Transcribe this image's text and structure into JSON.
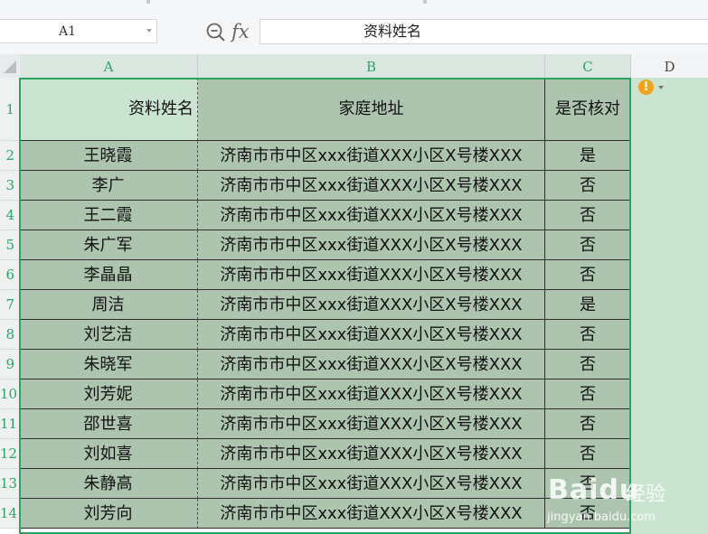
{
  "formula_bar": {
    "cell_ref": "A1",
    "fx_label": "fx",
    "content": "资料姓名"
  },
  "columns": [
    "A",
    "B",
    "C",
    "D"
  ],
  "header_row": {
    "row_num": "1",
    "a": "资料姓名",
    "b": "家庭地址",
    "c": "是否核对"
  },
  "rows": [
    {
      "row_num": "2",
      "name": "王晓霞",
      "address": "济南市市中区xxx街道XXX小区X号楼XXX",
      "checked": "是"
    },
    {
      "row_num": "3",
      "name": "李广",
      "address": "济南市市中区xxx街道XXX小区X号楼XXX",
      "checked": "否"
    },
    {
      "row_num": "4",
      "name": "王二霞",
      "address": "济南市市中区xxx街道XXX小区X号楼XXX",
      "checked": "否"
    },
    {
      "row_num": "5",
      "name": "朱广军",
      "address": "济南市市中区xxx街道XXX小区X号楼XXX",
      "checked": "否"
    },
    {
      "row_num": "6",
      "name": "李晶晶",
      "address": "济南市市中区xxx街道XXX小区X号楼XXX",
      "checked": "否"
    },
    {
      "row_num": "7",
      "name": "周洁",
      "address": "济南市市中区xxx街道XXX小区X号楼XXX",
      "checked": "是"
    },
    {
      "row_num": "8",
      "name": "刘艺洁",
      "address": "济南市市中区xxx街道XXX小区X号楼XXX",
      "checked": "否"
    },
    {
      "row_num": "9",
      "name": "朱晓军",
      "address": "济南市市中区xxx街道XXX小区X号楼XXX",
      "checked": "否"
    },
    {
      "row_num": "10",
      "name": "刘芳妮",
      "address": "济南市市中区xxx街道XXX小区X号楼XXX",
      "checked": "否"
    },
    {
      "row_num": "11",
      "name": "邵世喜",
      "address": "济南市市中区xxx街道XXX小区X号楼XXX",
      "checked": "否"
    },
    {
      "row_num": "12",
      "name": "刘如喜",
      "address": "济南市市中区xxx街道XXX小区X号楼XXX",
      "checked": "否"
    },
    {
      "row_num": "13",
      "name": "朱静高",
      "address": "济南市市中区xxx街道XXX小区X号楼XXX",
      "checked": "否"
    },
    {
      "row_num": "14",
      "name": "刘芳向",
      "address": "济南市市中区xxx街道XXX小区X号楼XXX",
      "checked": "否"
    }
  ],
  "icons": {
    "zoom": "zoom-search-icon",
    "warning": "warning-icon"
  },
  "colors": {
    "selection_border": "#2aa264",
    "selected_fill": "#adc5af",
    "active_cell_fill": "#cbe4d1",
    "header_text": "#2ca36a"
  },
  "watermark": {
    "brand": "Baidu",
    "label": "经验",
    "url": "jingyan.baidu.com"
  }
}
